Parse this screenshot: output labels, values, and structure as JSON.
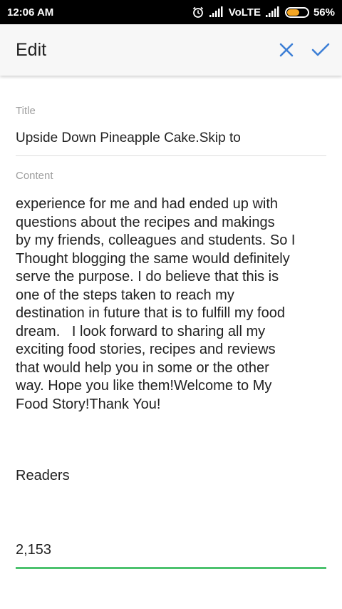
{
  "status_bar": {
    "time": "12:06 AM",
    "network": "VoLTE",
    "battery": "56%",
    "battery_level": 0.56,
    "icons": [
      "alarm-icon",
      "signal-icon",
      "signal-icon",
      "battery-icon"
    ]
  },
  "app_bar": {
    "title": "Edit",
    "close_icon": "close-icon",
    "confirm_icon": "check-icon",
    "accent_color": "#3d7fd6"
  },
  "form": {
    "title_label": "Title",
    "title_value": "Upside Down Pineapple Cake.Skip to",
    "content_label": "Content",
    "content_value": "experience for me and had ended up with\nquestions about the recipes and makings\nby my friends, colleagues and students. So I\nThought blogging the same would definitely\nserve the purpose. I do believe that this is\none of the steps taken to reach my\ndestination in future that is to fulfill my food\ndream.   I look forward to sharing all my\nexciting food stories, recipes and reviews\nthat would help you in some or the other\nway. Hope you like them!Welcome to My\nFood Story!Thank You!",
    "readers_label": "Readers",
    "readers_value": "2,153",
    "focus_color": "#4cc26e"
  }
}
